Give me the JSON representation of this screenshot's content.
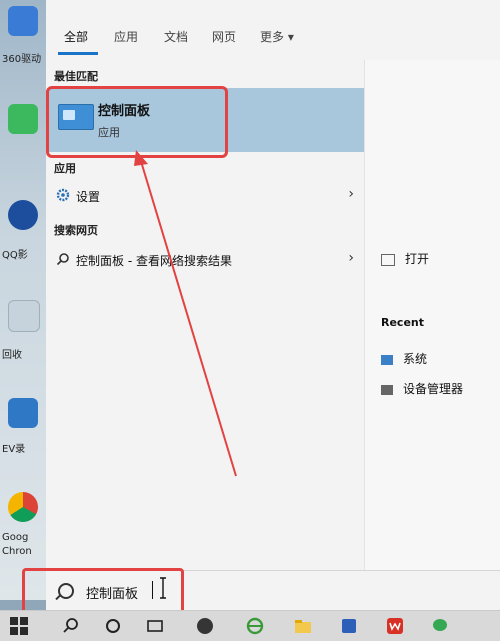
{
  "desktop": {
    "labels": [
      "360驱动",
      "QQ影",
      "回收",
      "EV录",
      "Goog",
      "Chron"
    ]
  },
  "menu": {
    "tabs": [
      {
        "label": "全部"
      },
      {
        "label": "应用"
      },
      {
        "label": "文档"
      },
      {
        "label": "网页"
      },
      {
        "label": "更多 ▾"
      }
    ],
    "best_match": {
      "header": "最佳匹配",
      "title": "控制面板",
      "subtitle": "应用"
    },
    "apps": {
      "header": "应用",
      "items": [
        {
          "label": "设置"
        }
      ]
    },
    "web": {
      "header": "搜索网页",
      "items": [
        {
          "label": "控制面板 - 查看网络搜索结果"
        }
      ]
    },
    "right": {
      "open_label": "打开",
      "recent_header": "Recent",
      "recent_items": [
        {
          "label": "系统"
        },
        {
          "label": "设备管理器"
        }
      ]
    }
  },
  "search": {
    "value": "控制面板"
  },
  "colors": {
    "highlight": "#e34242",
    "selection": "#a8c7dd",
    "accent": "#1a73c7"
  }
}
